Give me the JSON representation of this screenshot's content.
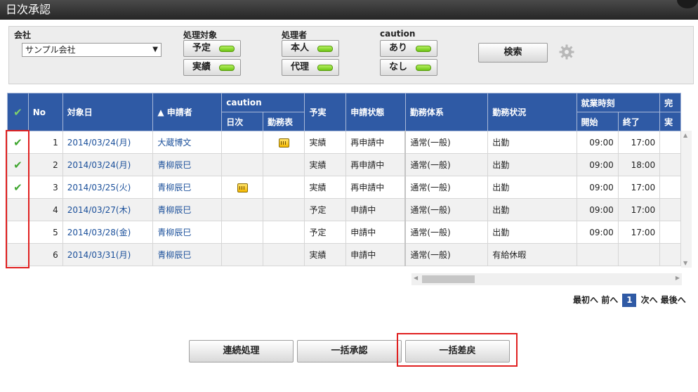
{
  "title": "日次承認",
  "search": {
    "company_label": "会社",
    "company_value": "サンプル会社",
    "target_label": "処理対象",
    "target_options": [
      "予定",
      "実績"
    ],
    "processor_label": "処理者",
    "processor_options": [
      "本人",
      "代理"
    ],
    "caution_label": "caution",
    "caution_options": [
      "あり",
      "なし"
    ],
    "search_button": "検索"
  },
  "table": {
    "headers": {
      "check": "✔",
      "no": "No",
      "date": "対象日",
      "applicant": "▲ 申請者",
      "caution": "caution",
      "caution_daily": "日次",
      "caution_sheet": "勤務表",
      "plan_actual": "予実",
      "status": "申請状態",
      "work_system": "勤務体系",
      "work_state": "勤務状況",
      "work_time": "就業時刻",
      "start": "開始",
      "end": "終了",
      "overflow": "完",
      "overflow_sub": "実"
    },
    "rows": [
      {
        "checked": "✔",
        "no": "1",
        "date": "2014/03/24(月)",
        "applicant": "大蔵博文",
        "daily_icon": false,
        "sheet_icon": true,
        "plan_actual": "実績",
        "status": "再申請中",
        "work_system": "通常(一般)",
        "work_state": "出勤",
        "start": "09:00",
        "end": "17:00"
      },
      {
        "checked": "✔",
        "no": "2",
        "date": "2014/03/24(月)",
        "applicant": "青柳辰巳",
        "daily_icon": false,
        "sheet_icon": false,
        "plan_actual": "実績",
        "status": "再申請中",
        "work_system": "通常(一般)",
        "work_state": "出勤",
        "start": "09:00",
        "end": "18:00"
      },
      {
        "checked": "✔",
        "no": "3",
        "date": "2014/03/25(火)",
        "applicant": "青柳辰巳",
        "daily_icon": true,
        "sheet_icon": false,
        "plan_actual": "実績",
        "status": "再申請中",
        "work_system": "通常(一般)",
        "work_state": "出勤",
        "start": "09:00",
        "end": "17:00"
      },
      {
        "checked": "",
        "no": "4",
        "date": "2014/03/27(木)",
        "applicant": "青柳辰巳",
        "daily_icon": false,
        "sheet_icon": false,
        "plan_actual": "予定",
        "status": "申請中",
        "work_system": "通常(一般)",
        "work_state": "出勤",
        "start": "09:00",
        "end": "17:00"
      },
      {
        "checked": "",
        "no": "5",
        "date": "2014/03/28(金)",
        "applicant": "青柳辰巳",
        "daily_icon": false,
        "sheet_icon": false,
        "plan_actual": "予定",
        "status": "申請中",
        "work_system": "通常(一般)",
        "work_state": "出勤",
        "start": "09:00",
        "end": "17:00"
      },
      {
        "checked": "",
        "no": "6",
        "date": "2014/03/31(月)",
        "applicant": "青柳辰巳",
        "daily_icon": false,
        "sheet_icon": false,
        "plan_actual": "実績",
        "status": "申請中",
        "work_system": "通常(一般)",
        "work_state": "有給休暇",
        "start": "",
        "end": ""
      }
    ]
  },
  "pager": {
    "first": "最初へ",
    "prev": "前へ",
    "current": "1",
    "next": "次へ",
    "last": "最後へ"
  },
  "actions": {
    "continuous": "連続処理",
    "bulk_approve": "一括承認",
    "bulk_return": "一括差戻"
  },
  "colors": {
    "header_bg": "#2f5aa5",
    "link": "#1a4f9a",
    "highlight": "#e02020",
    "led_green": "#6cc414"
  }
}
